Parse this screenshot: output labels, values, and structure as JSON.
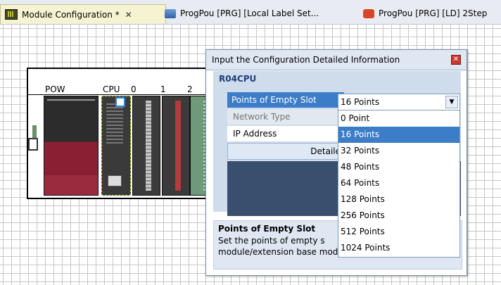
{
  "tabs": [
    {
      "label": "Module Configuration *",
      "icon": "module-config-icon",
      "active": true,
      "closable": true
    },
    {
      "label": "ProgPou [PRG] [Local Label Set...",
      "icon": "label-set-icon",
      "active": false
    },
    {
      "label": "ProgPou [PRG] [LD] 2Step",
      "icon": "ladder-icon",
      "active": false
    }
  ],
  "base": {
    "slots": [
      "POW",
      "CPU",
      "0",
      "1",
      "2"
    ]
  },
  "dialog": {
    "title": "Input the Configuration Detailed Information",
    "module": "R04CPU",
    "rows": [
      {
        "label": "Points of Empty Slot",
        "value": "16 Points"
      },
      {
        "label": "Network Type"
      },
      {
        "label": "IP Address"
      }
    ],
    "detail_button": "Detaile",
    "description": {
      "title": "Points of Empty Slot",
      "line1": "Set the points of empty s",
      "line2": "module/extension base module."
    }
  },
  "dropdown": {
    "selected": "16 Points",
    "options": [
      "0 Point",
      "16 Points",
      "32 Points",
      "48 Points",
      "64 Points",
      "128 Points",
      "256 Points",
      "512 Points",
      "1024 Points"
    ]
  },
  "colors": {
    "selection": "#3d7dc8",
    "property_bg": "#cfdcec",
    "dark_panel": "#3a4f6e",
    "power_module": "#8a1f33"
  }
}
